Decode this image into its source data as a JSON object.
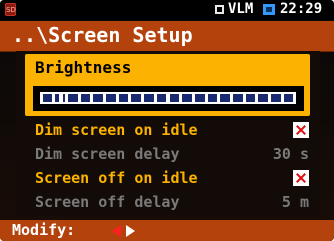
{
  "status_bar": {
    "mode": "VLM",
    "time": "22:29",
    "icons": [
      "sd-card-icon",
      "mode-square-icon",
      "battery-icon"
    ]
  },
  "header": {
    "path_title": "..\\Screen Setup"
  },
  "brightness": {
    "label": "Brightness",
    "level_fraction": 0.07,
    "segments": 20
  },
  "settings": [
    {
      "label": "Dim screen on idle",
      "type": "checkbox",
      "checked": true,
      "enabled": true
    },
    {
      "label": "Dim screen delay",
      "type": "value",
      "value": "30 s",
      "enabled": false
    },
    {
      "label": "Screen off on idle",
      "type": "checkbox",
      "checked": true,
      "enabled": true
    },
    {
      "label": "Screen off delay",
      "type": "value",
      "value": "5 m",
      "enabled": false
    }
  ],
  "footer": {
    "hint": "Modify:",
    "arrows": [
      "arrow-left-icon",
      "arrow-right-icon"
    ]
  },
  "colors": {
    "accent": "#fbb200",
    "header_bar": "#b3420c",
    "disabled_text": "#7a7a7a",
    "check_mark": "#e01010"
  }
}
